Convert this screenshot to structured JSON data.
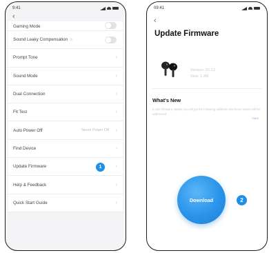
{
  "left_screen": {
    "status_time": "9:41",
    "settings": [
      {
        "label": "Gaming Mode",
        "control": "toggle"
      },
      {
        "label": "Sound Leaky Compensation",
        "tag": "①",
        "control": "toggle"
      },
      {
        "label": "Prompt Tone",
        "control": "chevron"
      },
      {
        "label": "Sound Mode",
        "control": "chevron"
      },
      {
        "label": "Dual Connection",
        "control": "chevron"
      },
      {
        "label": "Fit Test",
        "control": "chevron"
      },
      {
        "label": "Auto Power Off",
        "value": "Never Power Off",
        "control": "chevron"
      },
      {
        "label": "Find Device",
        "control": "chevron"
      },
      {
        "label": "Update Firmware",
        "control": "chevron",
        "badge": "1"
      },
      {
        "label": "Help & Feedback",
        "control": "chevron"
      },
      {
        "label": "Quick Start Guide",
        "control": "chevron"
      }
    ]
  },
  "right_screen": {
    "status_time": "09:41",
    "title": "Update Firmware",
    "version_text": "Version: 02.13",
    "size_text": "Size: 1.3M",
    "whats_new": "What's New",
    "description": "In this firmware update you will get the following additions and these issues will be addressed",
    "more_link": "more",
    "download_label": "Download",
    "badge": "2"
  },
  "colors": {
    "accent": "#1d8fe6",
    "download": "#2a93ea"
  },
  "icons": {
    "back": "chevron-left-icon",
    "row": "chevron-right-icon"
  }
}
